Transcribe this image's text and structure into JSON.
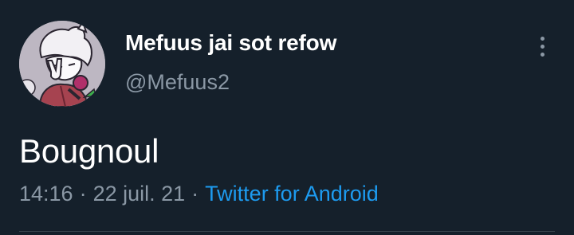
{
  "tweet": {
    "display_name": "Mefuus jai sot refow",
    "handle": "@Mefuus2",
    "text": "Bougnoul",
    "time": "14:16",
    "date": "22 juil. 21",
    "separator": "·",
    "source": "Twitter for Android"
  },
  "icons": {
    "avatar": "profile-avatar",
    "more": "more-vertical-icon"
  },
  "colors": {
    "background": "#15202b",
    "name": "#ffffff",
    "secondary": "#8b98a5",
    "link": "#1d9bf0",
    "divider": "#38444d"
  }
}
